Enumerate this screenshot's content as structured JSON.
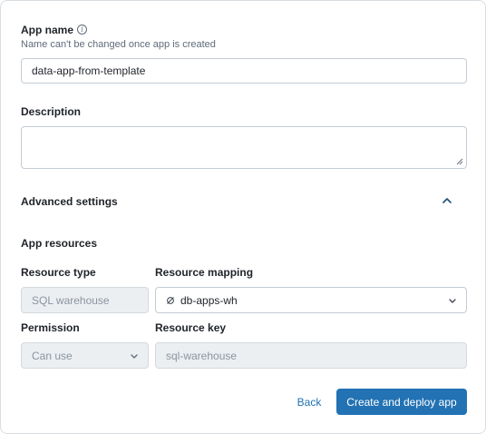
{
  "app_name": {
    "label": "App name",
    "hint": "Name can't be changed once app is created",
    "value": "data-app-from-template"
  },
  "description": {
    "label": "Description",
    "value": ""
  },
  "advanced": {
    "label": "Advanced settings",
    "toggle_icon": "chevron-up-icon"
  },
  "resources": {
    "title": "App resources",
    "resource_type_label": "Resource type",
    "resource_type_value": "SQL warehouse",
    "resource_mapping_label": "Resource mapping",
    "resource_mapping_value": "db-apps-wh",
    "permission_label": "Permission",
    "permission_value": "Can use",
    "resource_key_label": "Resource key",
    "resource_key_value": "sql-warehouse"
  },
  "footer": {
    "back_label": "Back",
    "submit_label": "Create and deploy app"
  },
  "colors": {
    "primary": "#2272b4",
    "disabled_bg": "#eceff2",
    "border": "#c4ccd4"
  }
}
